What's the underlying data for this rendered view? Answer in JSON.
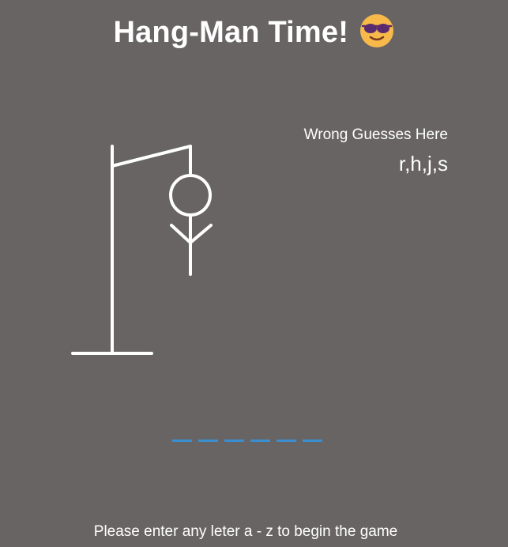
{
  "header": {
    "title": "Hang-Man Time!",
    "emoji_icon": "sunglasses-face-icon"
  },
  "wrong_guesses": {
    "label": "Wrong Guesses Here",
    "letters": "r,h,j,s"
  },
  "word": {
    "blank_count": 6,
    "blank_color": "#3a8ed0"
  },
  "instructions": "Please enter any leter a - z to begin the game",
  "colors": {
    "background": "#686464",
    "text": "#ffffff",
    "emoji_face": "#f7b94a",
    "emoji_glasses": "#5a2a6e"
  }
}
